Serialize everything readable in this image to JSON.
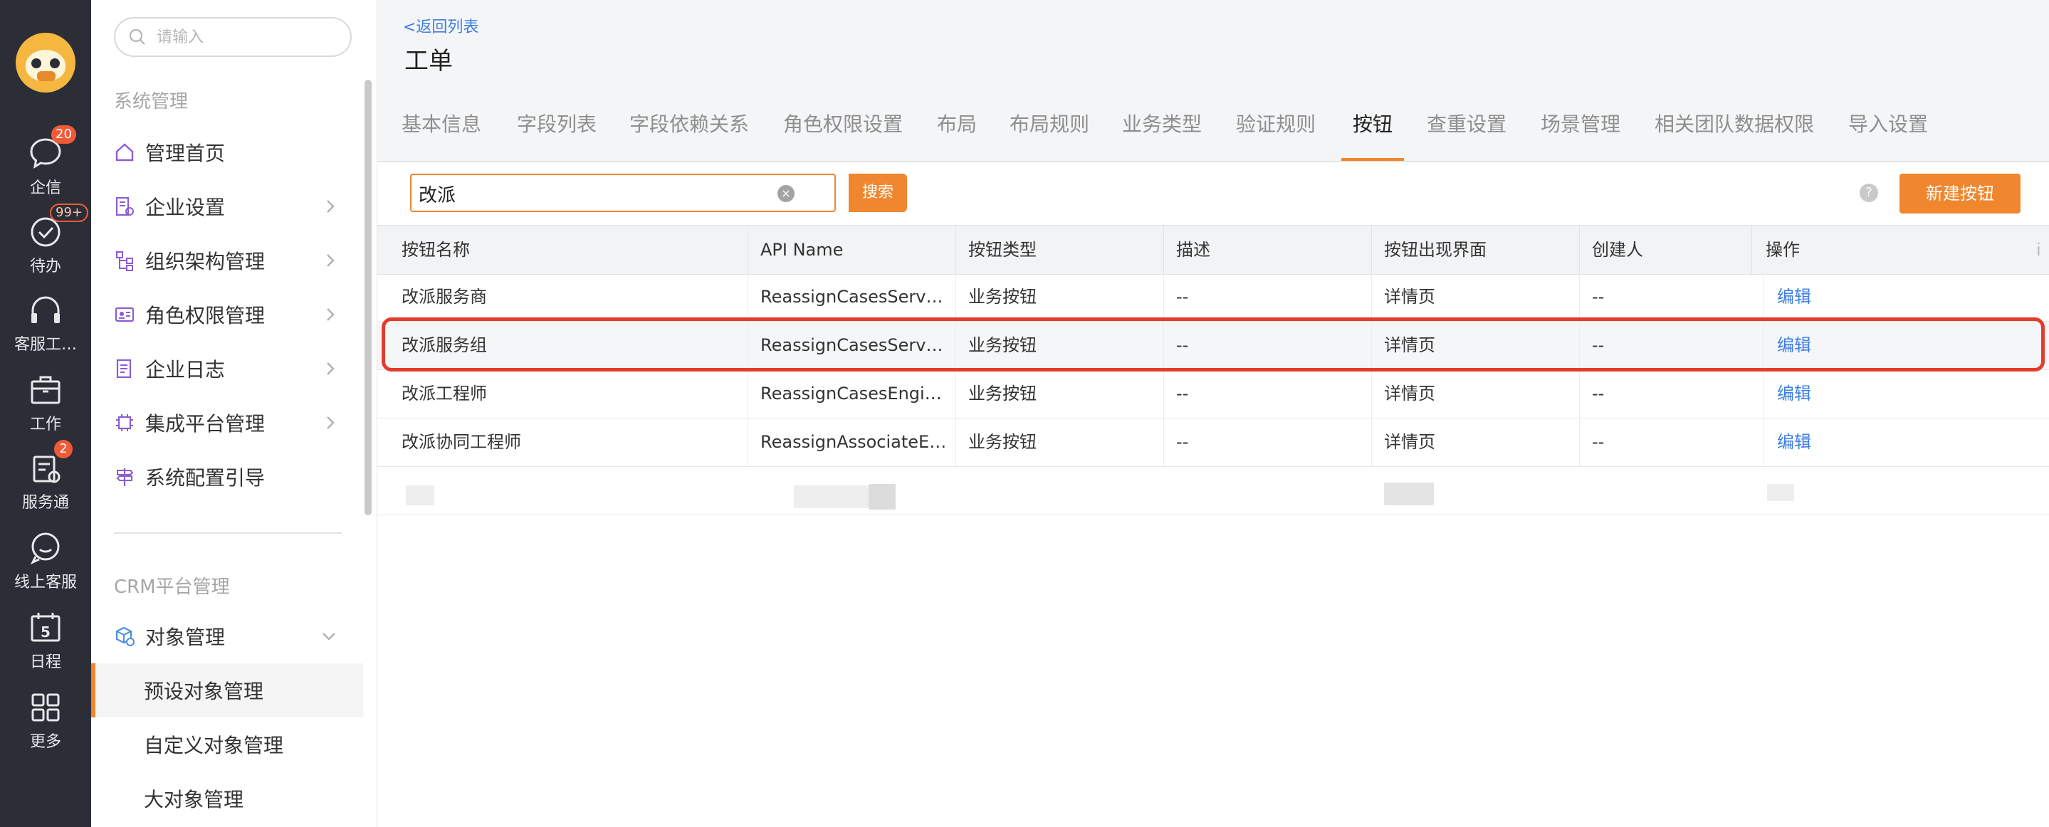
{
  "rail": {
    "items": [
      {
        "label": "企信",
        "icon": "chat-bubble-icon",
        "badge": "20"
      },
      {
        "label": "待办",
        "icon": "check-circle-icon",
        "badge": "99+"
      },
      {
        "label": "客服工…",
        "icon": "headset-icon",
        "badge": ""
      },
      {
        "label": "工作",
        "icon": "briefcase-icon",
        "badge": ""
      },
      {
        "label": "服务通",
        "icon": "service-tool-icon",
        "badge": "2"
      },
      {
        "label": "线上客服",
        "icon": "smile-chat-icon",
        "badge": ""
      },
      {
        "label": "日程",
        "icon": "calendar-icon",
        "badge": "",
        "calendar_day": "5"
      },
      {
        "label": "更多",
        "icon": "grid-icon",
        "badge": ""
      }
    ]
  },
  "sidebar": {
    "search_placeholder": "请输入",
    "section1_title": "系统管理",
    "section1_items": [
      {
        "label": "管理首页",
        "icon": "home-icon",
        "has_chevron": false
      },
      {
        "label": "企业设置",
        "icon": "enterprise-settings-icon",
        "has_chevron": true
      },
      {
        "label": "组织架构管理",
        "icon": "org-tree-icon",
        "has_chevron": true
      },
      {
        "label": "角色权限管理",
        "icon": "id-card-icon",
        "has_chevron": true
      },
      {
        "label": "企业日志",
        "icon": "log-icon",
        "has_chevron": true
      },
      {
        "label": "集成平台管理",
        "icon": "chip-icon",
        "has_chevron": true
      },
      {
        "label": "系统配置引导",
        "icon": "signpost-icon",
        "has_chevron": false
      }
    ],
    "section2_title": "CRM平台管理",
    "object_mgmt_label": "对象管理",
    "sub_items": [
      "预设对象管理",
      "自定义对象管理",
      "大对象管理"
    ],
    "active_sub_item": "预设对象管理"
  },
  "header": {
    "back_link": "<返回列表",
    "title": "工单",
    "tabs": [
      "基本信息",
      "字段列表",
      "字段依赖关系",
      "角色权限设置",
      "布局",
      "布局规则",
      "业务类型",
      "验证规则",
      "按钮",
      "查重设置",
      "场景管理",
      "相关团队数据权限",
      "导入设置"
    ],
    "active_tab": "按钮"
  },
  "toolbar": {
    "search_value": "改派",
    "search_button": "搜索",
    "help": "?",
    "new_button": "新建按钮"
  },
  "table": {
    "columns": [
      "按钮名称",
      "API Name",
      "按钮类型",
      "描述",
      "按钮出现界面",
      "创建人",
      "操作",
      "i"
    ],
    "rows": [
      {
        "name": "改派服务商",
        "api": "ReassignCasesServi…",
        "type": "业务按钮",
        "desc": "--",
        "ui": "详情页",
        "creator": "--",
        "action": "编辑"
      },
      {
        "name": "改派服务组",
        "api": "ReassignCasesServi…",
        "type": "业务按钮",
        "desc": "--",
        "ui": "详情页",
        "creator": "--",
        "action": "编辑"
      },
      {
        "name": "改派工程师",
        "api": "ReassignCasesEngin…",
        "type": "业务按钮",
        "desc": "--",
        "ui": "详情页",
        "creator": "--",
        "action": "编辑"
      },
      {
        "name": "改派协同工程师",
        "api": "ReassignAssociateE…",
        "type": "业务按钮",
        "desc": "--",
        "ui": "详情页",
        "creator": "--",
        "action": "编辑"
      }
    ],
    "highlighted_row": 1
  },
  "colors": {
    "accent": "#f0862d",
    "link": "#3d7ee4",
    "rail_bg": "#2b2e36",
    "highlight_border": "#e53b2b"
  }
}
